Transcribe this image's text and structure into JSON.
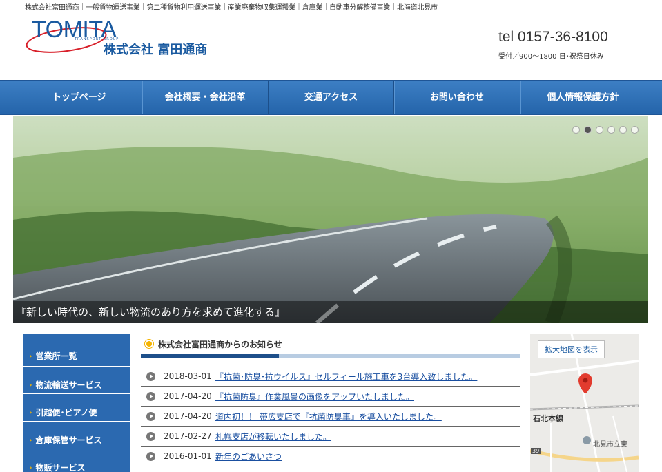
{
  "header": {
    "topline": "株式会社富田通商｜一般貨物運送事業｜第二種貨物利用運送事業｜産業廃棄物収集運搬業｜倉庫業｜自動車分解整備事業｜北海道北見市",
    "logo_main": "TOMITA",
    "logo_sub": "TRANSPORT GROUP",
    "company": "株式会社 富田通商",
    "tel": "tel 0157-36-8100",
    "hours": "受付／900～1800 日･祝祭日休み"
  },
  "nav": {
    "items": [
      "トップページ",
      "会社概要・会社沿革",
      "交通アクセス",
      "お問い合わせ",
      "個人情報保護方針"
    ]
  },
  "hero": {
    "caption": "『新しい時代の、新しい物流のあり方を求めて進化する』",
    "slide_count": 6,
    "active_slide": 2
  },
  "sidebar": {
    "items": [
      "営業所一覧",
      "物流輸送サービス",
      "引越便･ピアノ便",
      "倉庫保管サービス",
      "物販サービス"
    ]
  },
  "news": {
    "heading": "株式会社富田通商からのお知らせ",
    "items": [
      {
        "date": "2018-03-01",
        "title": "『抗菌･防臭･抗ウイルス』セルフィール施工車を3台導入致しました。"
      },
      {
        "date": "2017-04-20",
        "title": "『抗菌防臭』作業風景の画像をアップいたしました。"
      },
      {
        "date": "2017-04-20",
        "title": "道内初！！ 帯広支店で『抗菌防臭車』を導入いたしました。"
      },
      {
        "date": "2017-02-27",
        "title": "札幌支店が移転いたしました。"
      },
      {
        "date": "2016-01-01",
        "title": "新年のごあいさつ"
      }
    ]
  },
  "map": {
    "button": "拡大地図を表示",
    "label_rail": "石北本線",
    "label_place": "北見市立東",
    "route_no": "39"
  },
  "colors": {
    "brand_blue": "#2b69b0",
    "accent_yellow": "#f5b400",
    "link_blue": "#1a4fa0"
  }
}
